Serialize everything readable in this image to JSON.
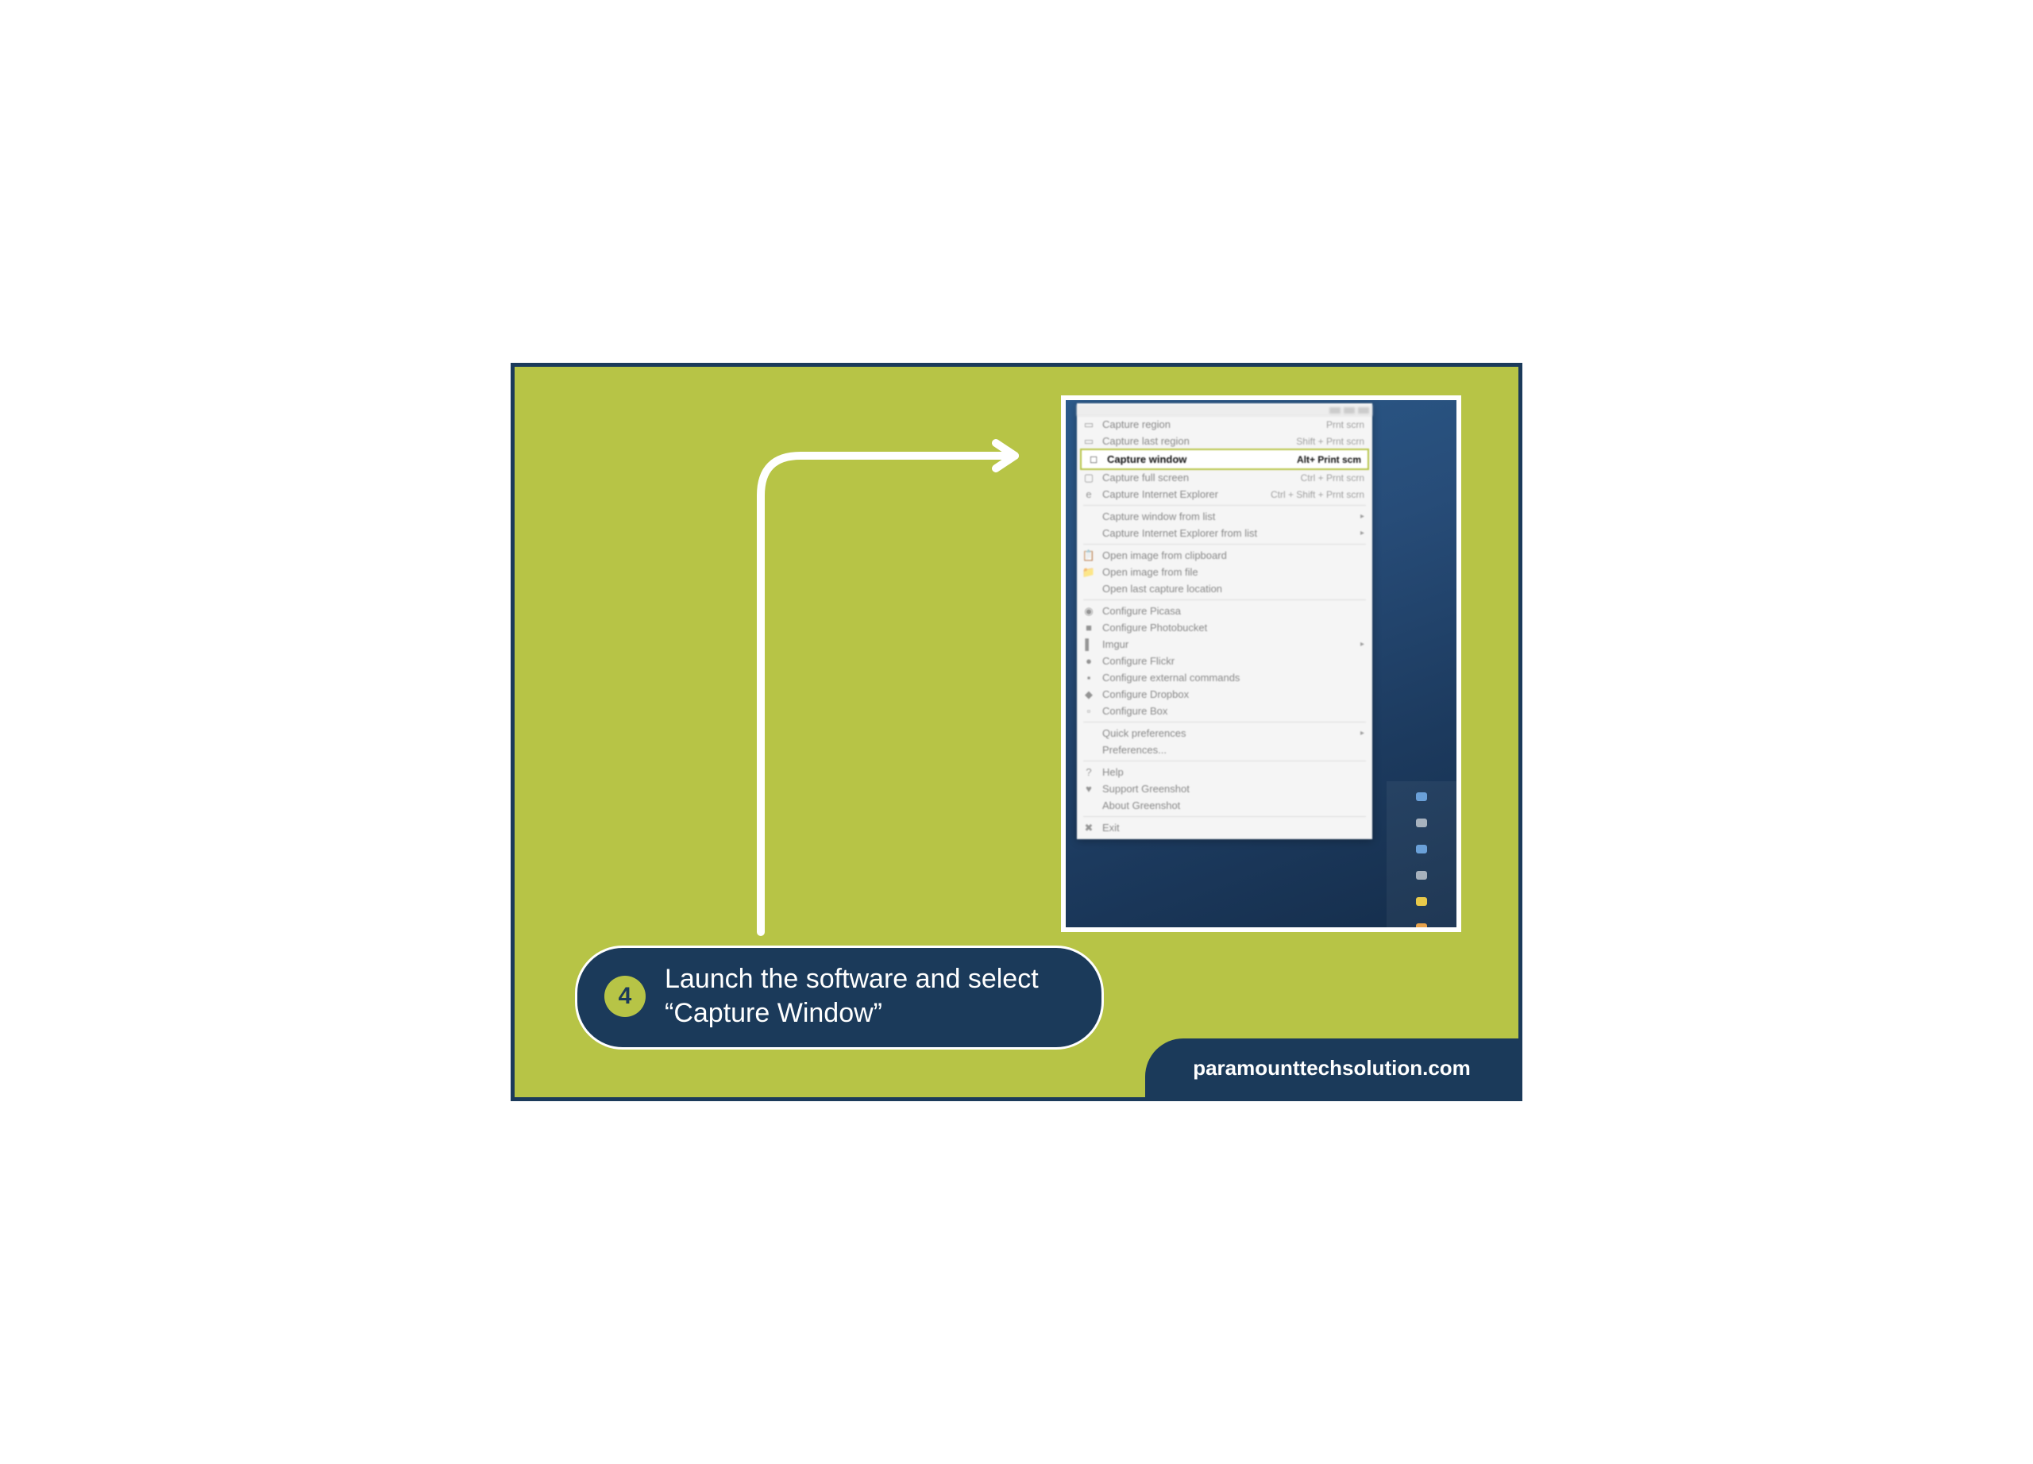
{
  "colors": {
    "bg": "#b7c446",
    "navy": "#1b3a5a",
    "white": "#ffffff"
  },
  "arrow": {
    "stroke": "#ffffff"
  },
  "caption": {
    "step": "4",
    "text": "Launch the software and select “Capture Window”"
  },
  "footer": {
    "brand": "paramounttechsolution.com"
  },
  "highlight": {
    "icon_name": "window-icon",
    "label": "Capture window",
    "shortcut": "Alt+ Print scm"
  },
  "menu": {
    "groups": [
      [
        {
          "icon": "region-icon",
          "label": "Capture region",
          "shortcut": "Prnt scrn"
        },
        {
          "icon": "region-icon",
          "label": "Capture last region",
          "shortcut": "Shift + Prnt scrn"
        },
        {
          "icon": "window-icon",
          "label": "Capture window",
          "shortcut": "Alt+ Print scm",
          "highlight": true
        },
        {
          "icon": "fullscreen-icon",
          "label": "Capture full screen",
          "shortcut": "Ctrl + Prnt scrn"
        },
        {
          "icon": "ie-icon",
          "label": "Capture Internet Explorer",
          "shortcut": "Ctrl + Shift + Prnt scrn"
        }
      ],
      [
        {
          "icon": "",
          "label": "Capture window from list",
          "submenu": true
        },
        {
          "icon": "",
          "label": "Capture Internet Explorer from list",
          "submenu": true
        }
      ],
      [
        {
          "icon": "clipboard-icon",
          "label": "Open image from clipboard"
        },
        {
          "icon": "folder-icon",
          "label": "Open image from file"
        },
        {
          "icon": "",
          "label": "Open last capture location"
        }
      ],
      [
        {
          "icon": "picasa-icon",
          "label": "Configure Picasa"
        },
        {
          "icon": "photobucket-icon",
          "label": "Configure Photobucket"
        },
        {
          "icon": "imgur-icon",
          "label": "Imgur",
          "submenu": true
        },
        {
          "icon": "flickr-icon",
          "label": "Configure Flickr"
        },
        {
          "icon": "terminal-icon",
          "label": "Configure external commands"
        },
        {
          "icon": "dropbox-icon",
          "label": "Configure Dropbox"
        },
        {
          "icon": "box-icon",
          "label": "Configure Box"
        }
      ],
      [
        {
          "icon": "",
          "label": "Quick preferences",
          "submenu": true
        },
        {
          "icon": "",
          "label": "Preferences..."
        }
      ],
      [
        {
          "icon": "help-icon",
          "label": "Help"
        },
        {
          "icon": "support-icon",
          "label": "Support Greenshot"
        },
        {
          "icon": "",
          "label": "About Greenshot"
        }
      ],
      [
        {
          "icon": "exit-icon",
          "label": "Exit"
        }
      ]
    ]
  }
}
